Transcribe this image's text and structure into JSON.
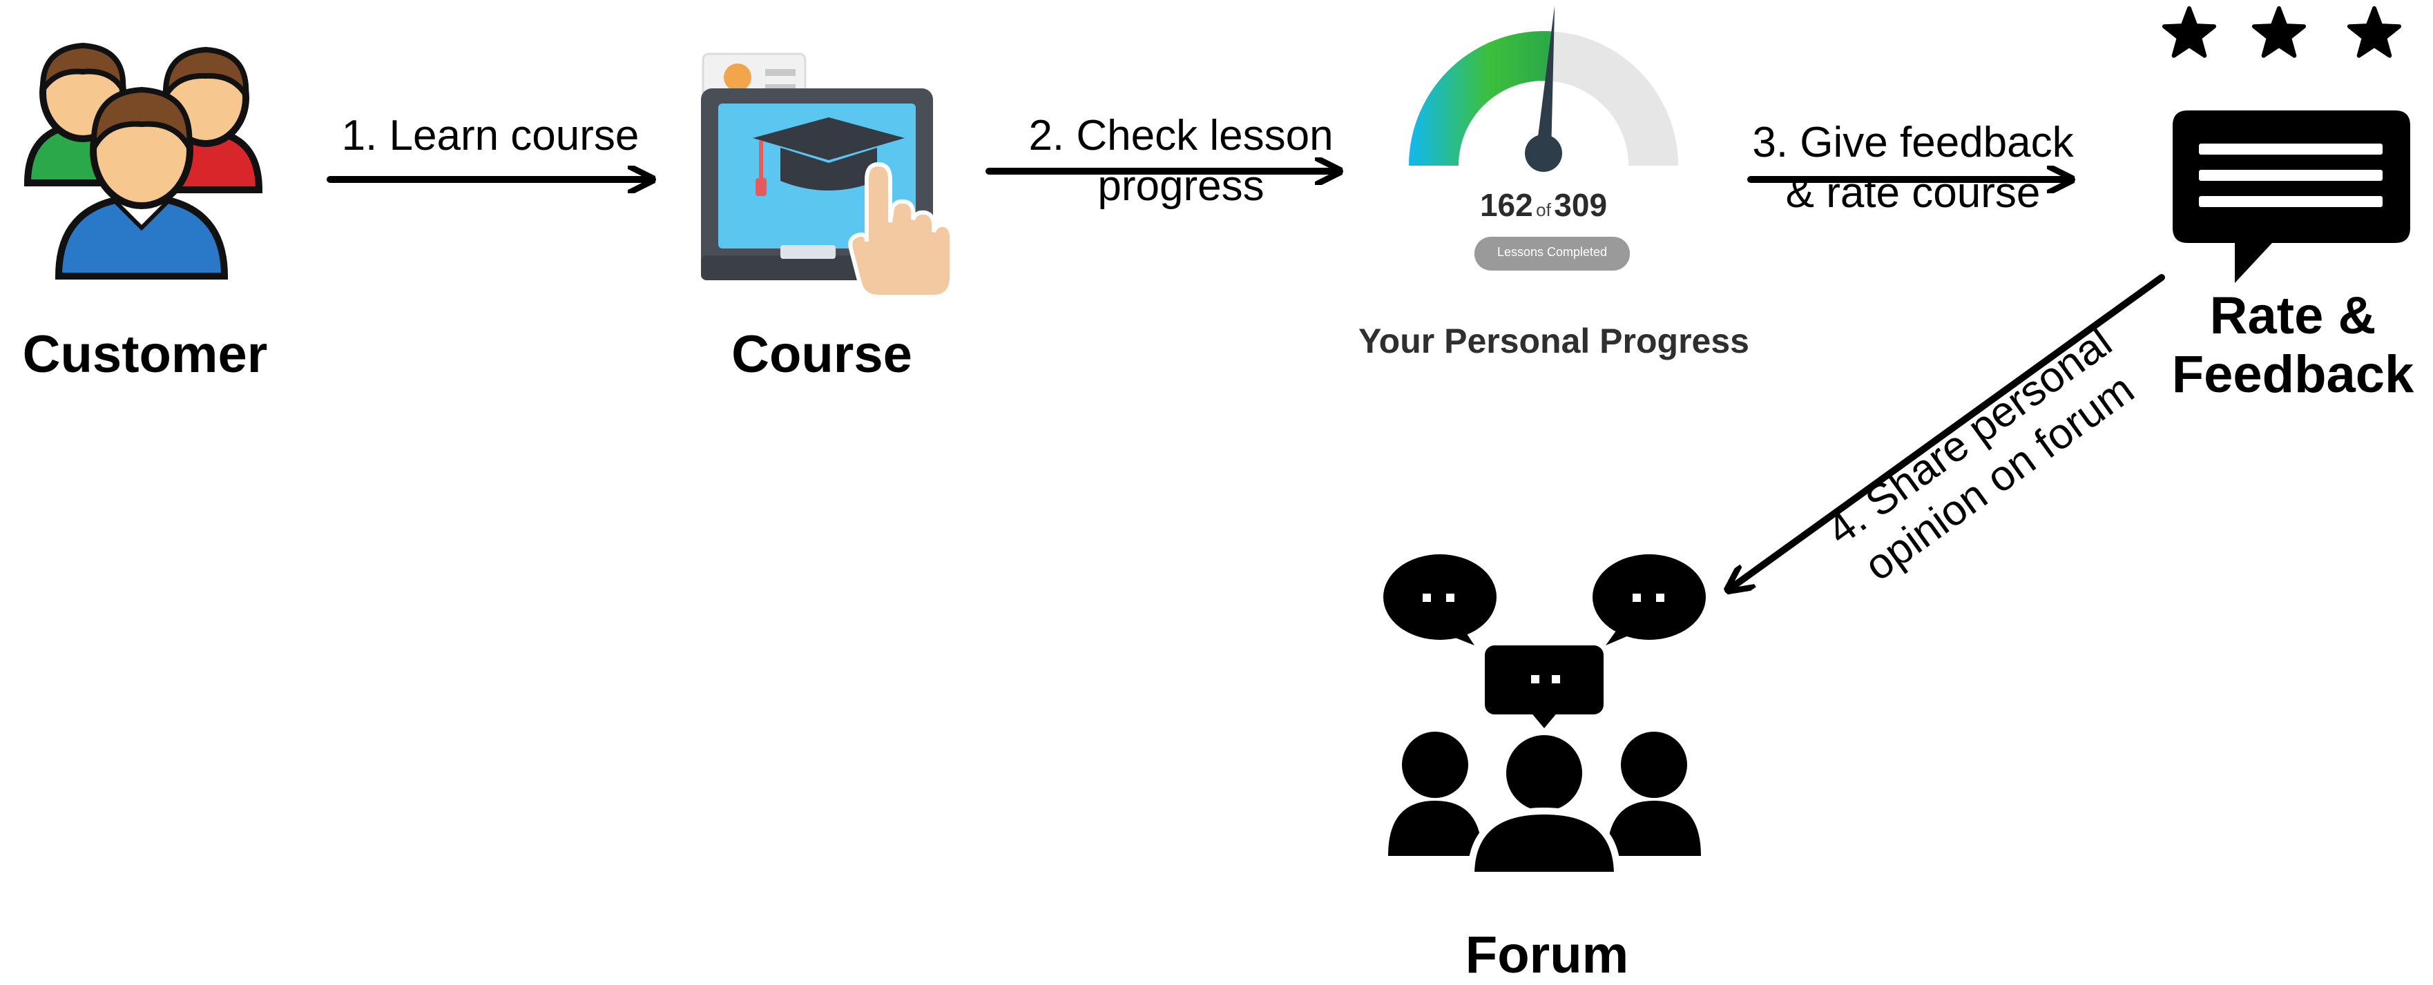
{
  "nodes": {
    "customer": {
      "label": "Customer"
    },
    "course": {
      "label": "Course"
    },
    "progress": {
      "title": "Your Personal Progress",
      "completed": "162",
      "of_word": "of",
      "total": "309",
      "pill_text": "Lessons Completed",
      "fraction": 0.524
    },
    "rate": {
      "label_line1": "Rate &",
      "label_line2": "Feedback",
      "stars": 3
    },
    "forum": {
      "label": "Forum"
    }
  },
  "edges": [
    {
      "id": "learn",
      "line1": "1. Learn course"
    },
    {
      "id": "check",
      "line1": "2. Check lesson",
      "line2": "progress"
    },
    {
      "id": "feedback",
      "line1": "3. Give feedback",
      "line2": "& rate course"
    },
    {
      "id": "share",
      "line1": "4. Share personal",
      "line2": "opinion on forum"
    }
  ],
  "colors": {
    "gauge_start": "#12b8f0",
    "gauge_mid": "#3cbf3c",
    "gauge_track": "#e6e6e6",
    "needle": "#2e3d4a",
    "user_red": "#d8262a",
    "user_green": "#2aa84a",
    "user_blue": "#2a78c8",
    "skin": "#f6c78e",
    "hair": "#7a4a26",
    "screen": "#5bc6f0"
  }
}
